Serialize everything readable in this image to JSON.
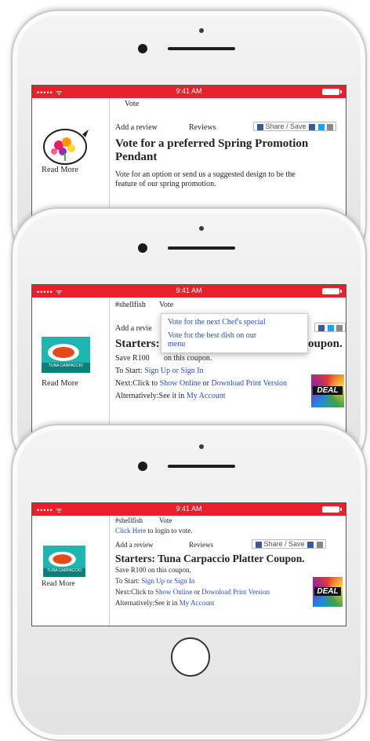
{
  "status_bar": {
    "signal": "••••• ᯤ",
    "time": "9:41 AM"
  },
  "screen1": {
    "tab_vote": "Vote",
    "add_review": "Add a review",
    "reviews": "Reviews",
    "share": "Share / Save",
    "title_line1": "Vote for a preferred Spring Promotion",
    "title_line2": "Pendant",
    "desc_line1": "Vote for an option or send us a suggested design to be the",
    "desc_line2": "feature of our spring promotion.",
    "read_more": "Read More"
  },
  "screen2": {
    "tag": "#shellfish",
    "tab_vote": "Vote",
    "add_review": "Add a revie",
    "title_left": "Starters:",
    "title_right": "oupon.",
    "save_text": "Save R100",
    "save_tail": "on this coupon.",
    "to_start": "To Start:",
    "signup": "Sign Up or Sign In",
    "next": "Next:Click to",
    "show_online": "Show Online",
    "or": "or",
    "download": "Download Print Version",
    "alt": "Alternatively:See it in",
    "my_account": "My Account",
    "read_more": "Read More",
    "dropdown_item1": "Vote for the next Chef's special",
    "dropdown_item2": "Vote for the best dish on our",
    "dropdown_item2b": "menu",
    "thumb_caption": "TUNA CARPACCIO",
    "deal": "DEAL"
  },
  "screen3": {
    "tag": "#shellfish",
    "tab_vote": "Vote",
    "click_here": "Click Here",
    "to_login": "to login to vote.",
    "add_review": "Add a review",
    "reviews": "Reviews",
    "share": "Share / Save",
    "title": "Starters: Tuna Carpaccio Platter Coupon.",
    "save_text": "Save R100 on this coupon.",
    "to_start": "To Start:",
    "signup": "Sign Up or Sign In",
    "next": "Next:Click to",
    "show_online": "Show Online",
    "or": "or",
    "download": "Download Print Version",
    "alt": "Alternatively:See it in",
    "my_account": "My Account",
    "read_more": "Read More",
    "thumb_caption": "TUNA CARPACCIO",
    "deal": "DEAL"
  },
  "colors": {
    "status_red": "#e8202b",
    "link_blue": "#2a4fb8",
    "fb_blue": "#3b5998",
    "tw_blue": "#1da1f2"
  }
}
